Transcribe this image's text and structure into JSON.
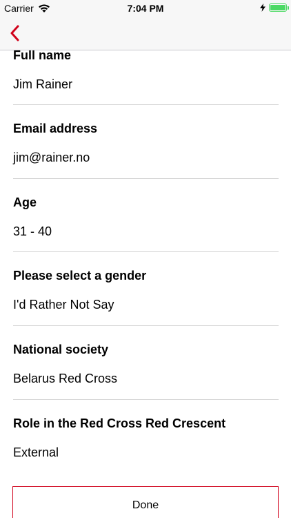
{
  "status_bar": {
    "carrier": "Carrier",
    "time": "7:04 PM",
    "battery_level": 1.0,
    "battery_color": "#4cd964"
  },
  "nav": {
    "back_icon": "chevron-left-icon",
    "accent_color": "#d0021b"
  },
  "fields": [
    {
      "label": "Full name",
      "value": "Jim Rainer"
    },
    {
      "label": "Email address",
      "value": "jim@rainer.no"
    },
    {
      "label": "Age",
      "value": "31 - 40"
    },
    {
      "label": "Please select a gender",
      "value": "I'd Rather Not Say"
    },
    {
      "label": "National society",
      "value": "Belarus Red Cross"
    },
    {
      "label": "Role in the Red Cross Red Crescent",
      "value": "External"
    }
  ],
  "done_label": "Done"
}
